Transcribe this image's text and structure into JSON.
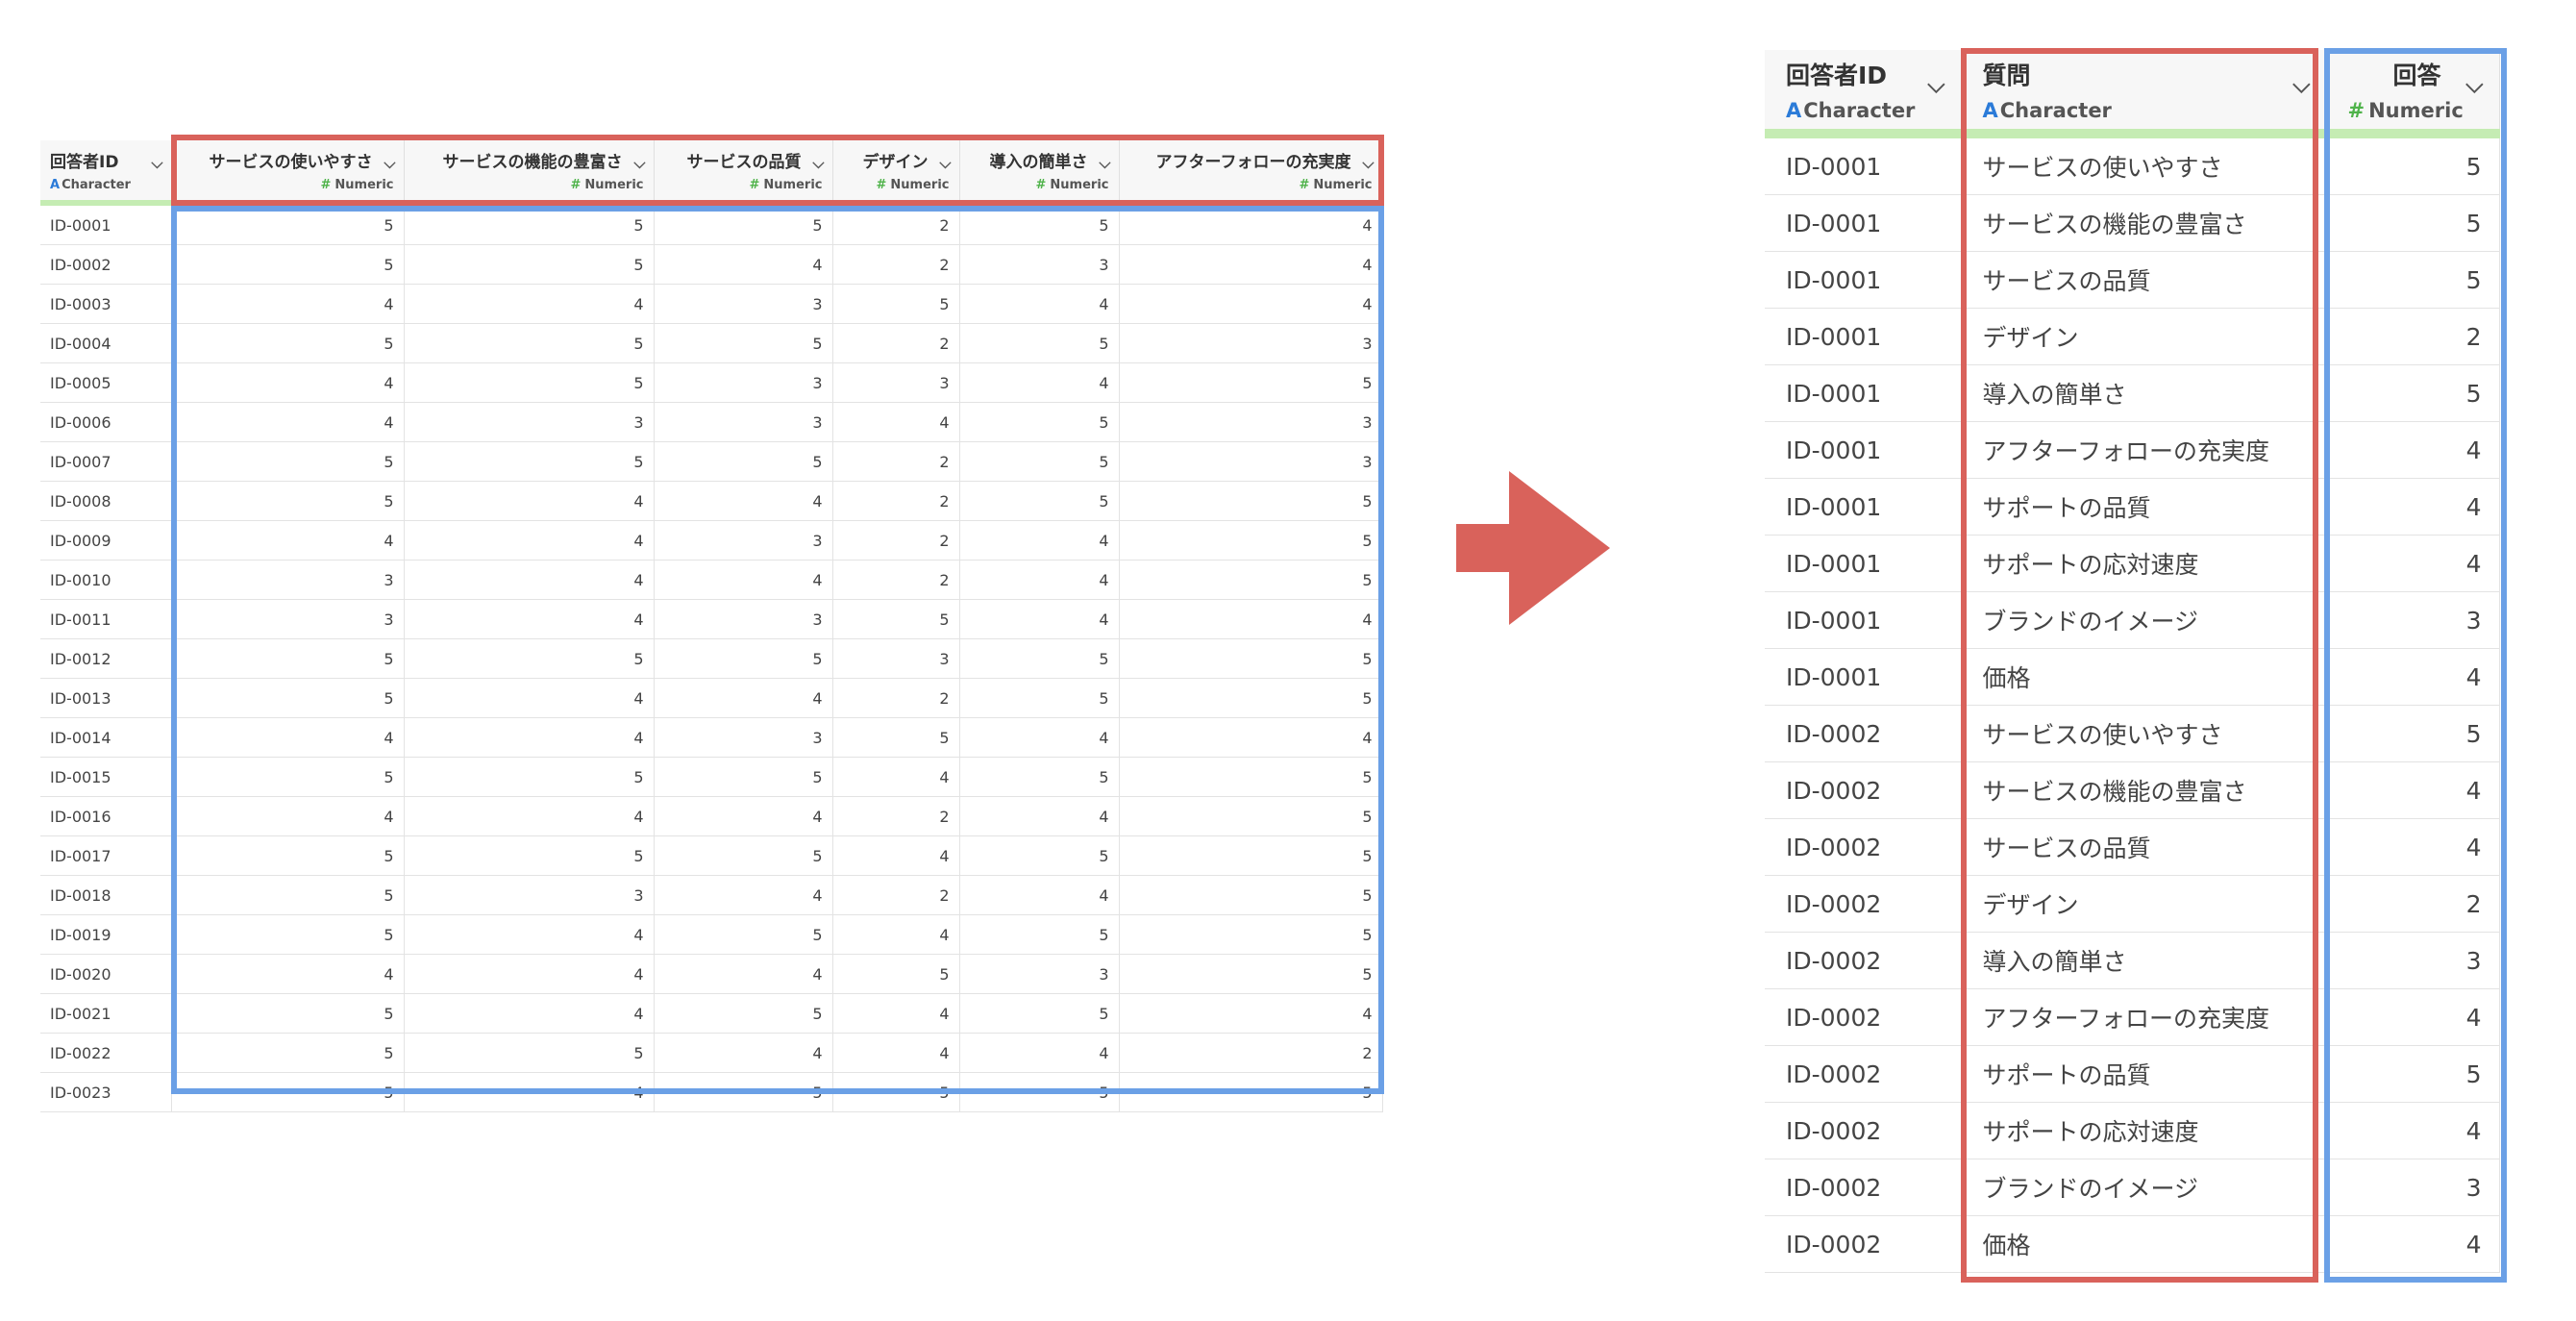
{
  "colors": {
    "red_box": "#d9625b",
    "blue_box": "#6ba0e6",
    "arrow": "#d9625b",
    "type_bar": "#c5ecb3",
    "char_icon": "#2b7bd8",
    "num_icon": "#4fb34a"
  },
  "wide": {
    "columns": [
      {
        "name": "回答者ID",
        "type": "Character"
      },
      {
        "name": "サービスの使いやすさ",
        "type": "Numeric"
      },
      {
        "name": "サービスの機能の豊富さ",
        "type": "Numeric"
      },
      {
        "name": "サービスの品質",
        "type": "Numeric"
      },
      {
        "name": "デザイン",
        "type": "Numeric"
      },
      {
        "name": "導入の簡単さ",
        "type": "Numeric"
      },
      {
        "name": "アフターフォローの充実度",
        "type": "Numeric"
      }
    ],
    "rows": [
      [
        "ID-0001",
        "5",
        "5",
        "5",
        "2",
        "5",
        "4"
      ],
      [
        "ID-0002",
        "5",
        "5",
        "4",
        "2",
        "3",
        "4"
      ],
      [
        "ID-0003",
        "4",
        "4",
        "3",
        "5",
        "4",
        "4"
      ],
      [
        "ID-0004",
        "5",
        "5",
        "5",
        "2",
        "5",
        "3"
      ],
      [
        "ID-0005",
        "4",
        "5",
        "3",
        "3",
        "4",
        "5"
      ],
      [
        "ID-0006",
        "4",
        "3",
        "3",
        "4",
        "5",
        "3"
      ],
      [
        "ID-0007",
        "5",
        "5",
        "5",
        "2",
        "5",
        "3"
      ],
      [
        "ID-0008",
        "5",
        "4",
        "4",
        "2",
        "5",
        "5"
      ],
      [
        "ID-0009",
        "4",
        "4",
        "3",
        "2",
        "4",
        "5"
      ],
      [
        "ID-0010",
        "3",
        "4",
        "4",
        "2",
        "4",
        "5"
      ],
      [
        "ID-0011",
        "3",
        "4",
        "3",
        "5",
        "4",
        "4"
      ],
      [
        "ID-0012",
        "5",
        "5",
        "5",
        "3",
        "5",
        "5"
      ],
      [
        "ID-0013",
        "5",
        "4",
        "4",
        "2",
        "5",
        "5"
      ],
      [
        "ID-0014",
        "4",
        "4",
        "3",
        "5",
        "4",
        "4"
      ],
      [
        "ID-0015",
        "5",
        "5",
        "5",
        "4",
        "5",
        "5"
      ],
      [
        "ID-0016",
        "4",
        "4",
        "4",
        "2",
        "4",
        "5"
      ],
      [
        "ID-0017",
        "5",
        "5",
        "5",
        "4",
        "5",
        "5"
      ],
      [
        "ID-0018",
        "5",
        "3",
        "4",
        "2",
        "4",
        "5"
      ],
      [
        "ID-0019",
        "5",
        "4",
        "5",
        "4",
        "5",
        "5"
      ],
      [
        "ID-0020",
        "4",
        "4",
        "4",
        "5",
        "3",
        "5"
      ],
      [
        "ID-0021",
        "5",
        "4",
        "5",
        "4",
        "5",
        "4"
      ],
      [
        "ID-0022",
        "5",
        "5",
        "4",
        "4",
        "4",
        "2"
      ],
      [
        "ID-0023",
        "5",
        "4",
        "5",
        "5",
        "5",
        "5"
      ]
    ]
  },
  "long": {
    "columns": [
      {
        "name": "回答者ID",
        "type": "Character"
      },
      {
        "name": "質問",
        "type": "Character"
      },
      {
        "name": "回答",
        "type": "Numeric"
      }
    ],
    "rows": [
      [
        "ID-0001",
        "サービスの使いやすさ",
        "5"
      ],
      [
        "ID-0001",
        "サービスの機能の豊富さ",
        "5"
      ],
      [
        "ID-0001",
        "サービスの品質",
        "5"
      ],
      [
        "ID-0001",
        "デザイン",
        "2"
      ],
      [
        "ID-0001",
        "導入の簡単さ",
        "5"
      ],
      [
        "ID-0001",
        "アフターフォローの充実度",
        "4"
      ],
      [
        "ID-0001",
        "サポートの品質",
        "4"
      ],
      [
        "ID-0001",
        "サポートの応対速度",
        "4"
      ],
      [
        "ID-0001",
        "ブランドのイメージ",
        "3"
      ],
      [
        "ID-0001",
        "価格",
        "4"
      ],
      [
        "ID-0002",
        "サービスの使いやすさ",
        "5"
      ],
      [
        "ID-0002",
        "サービスの機能の豊富さ",
        "4"
      ],
      [
        "ID-0002",
        "サービスの品質",
        "4"
      ],
      [
        "ID-0002",
        "デザイン",
        "2"
      ],
      [
        "ID-0002",
        "導入の簡単さ",
        "3"
      ],
      [
        "ID-0002",
        "アフターフォローの充実度",
        "4"
      ],
      [
        "ID-0002",
        "サポートの品質",
        "5"
      ],
      [
        "ID-0002",
        "サポートの応対速度",
        "4"
      ],
      [
        "ID-0002",
        "ブランドのイメージ",
        "3"
      ],
      [
        "ID-0002",
        "価格",
        "4"
      ]
    ]
  }
}
